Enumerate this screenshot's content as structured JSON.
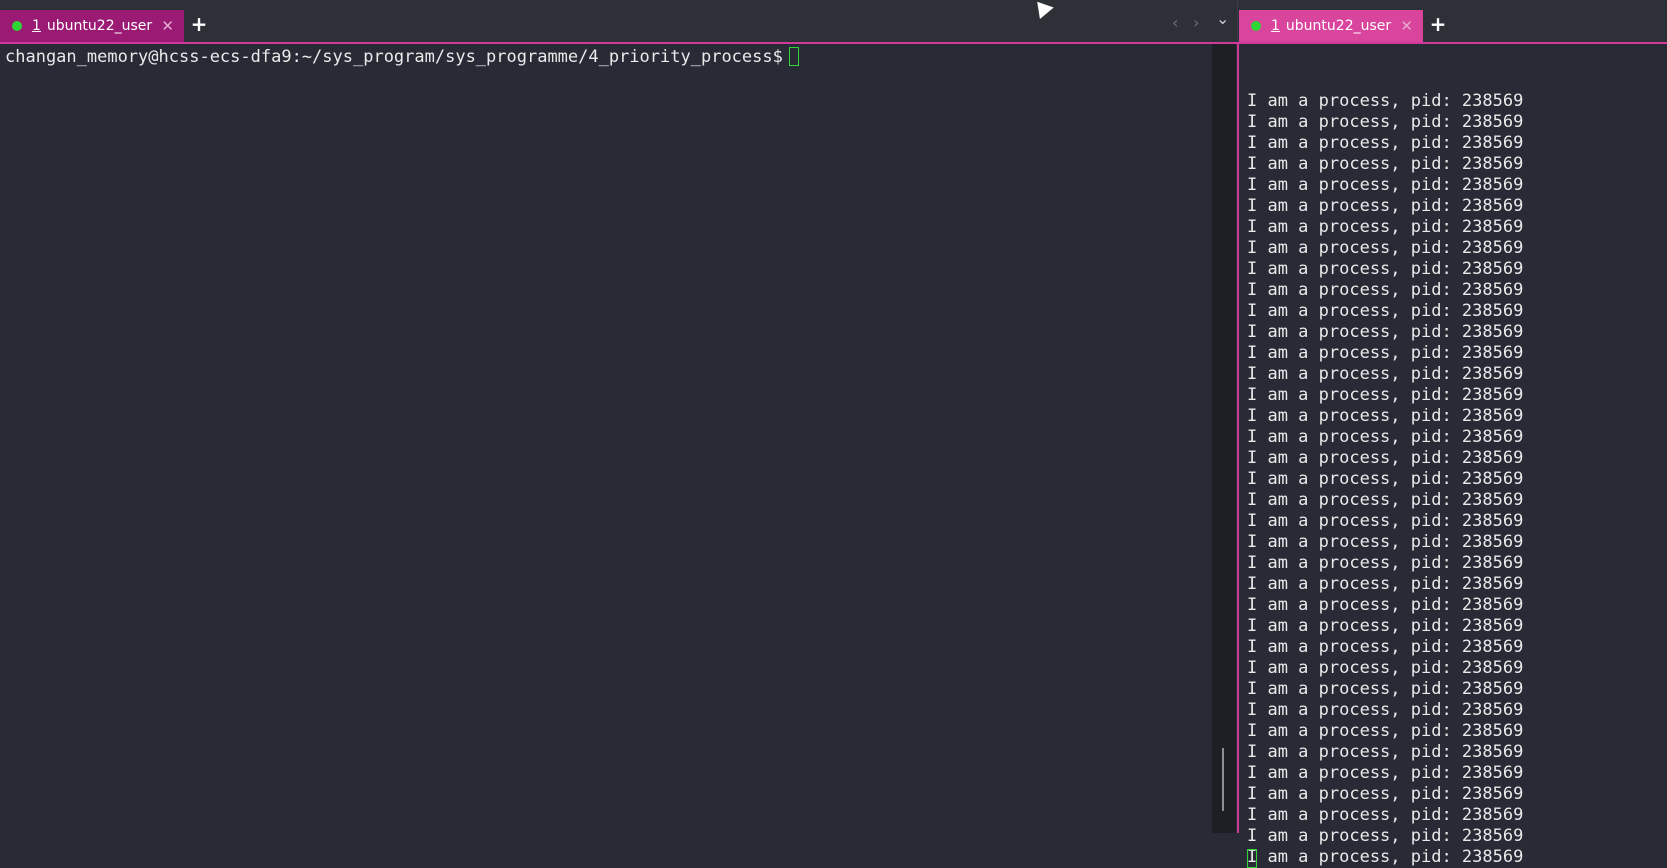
{
  "left": {
    "tab": {
      "number": "1",
      "title": "ubuntu22_user",
      "close": "✕"
    },
    "add_tab": "+",
    "prompt": "changan_memory@hcss-ecs-dfa9:~/sys_program/sys_programme/4_priority_process$"
  },
  "nav": {
    "prev": "‹",
    "next": "›",
    "dropdown": "⌄"
  },
  "right": {
    "tab": {
      "number": "1",
      "title": "ubuntu22_user",
      "close": "✕"
    },
    "add_tab": "+",
    "output_lines": [
      "I am a process, pid: 238569",
      "I am a process, pid: 238569",
      "I am a process, pid: 238569",
      "I am a process, pid: 238569",
      "I am a process, pid: 238569",
      "I am a process, pid: 238569",
      "I am a process, pid: 238569",
      "I am a process, pid: 238569",
      "I am a process, pid: 238569",
      "I am a process, pid: 238569",
      "I am a process, pid: 238569",
      "I am a process, pid: 238569",
      "I am a process, pid: 238569",
      "I am a process, pid: 238569",
      "I am a process, pid: 238569",
      "I am a process, pid: 238569",
      "I am a process, pid: 238569",
      "I am a process, pid: 238569",
      "I am a process, pid: 238569",
      "I am a process, pid: 238569",
      "I am a process, pid: 238569",
      "I am a process, pid: 238569",
      "I am a process, pid: 238569",
      "I am a process, pid: 238569",
      "I am a process, pid: 238569",
      "I am a process, pid: 238569",
      "I am a process, pid: 238569",
      "I am a process, pid: 238569",
      "I am a process, pid: 238569",
      "I am a process, pid: 238569",
      "I am a process, pid: 238569",
      "I am a process, pid: 238569",
      "I am a process, pid: 238569",
      "I am a process, pid: 238569",
      "I am a process, pid: 238569",
      "I am a process, pid: 238569",
      "I am a process, pid: 238569"
    ]
  },
  "colors": {
    "background": "#282a36",
    "tab_active_left": "#9b1b74",
    "tab_active_right": "#d9449d",
    "status_dot": "#2fd435",
    "cursor": "#2fd435"
  }
}
